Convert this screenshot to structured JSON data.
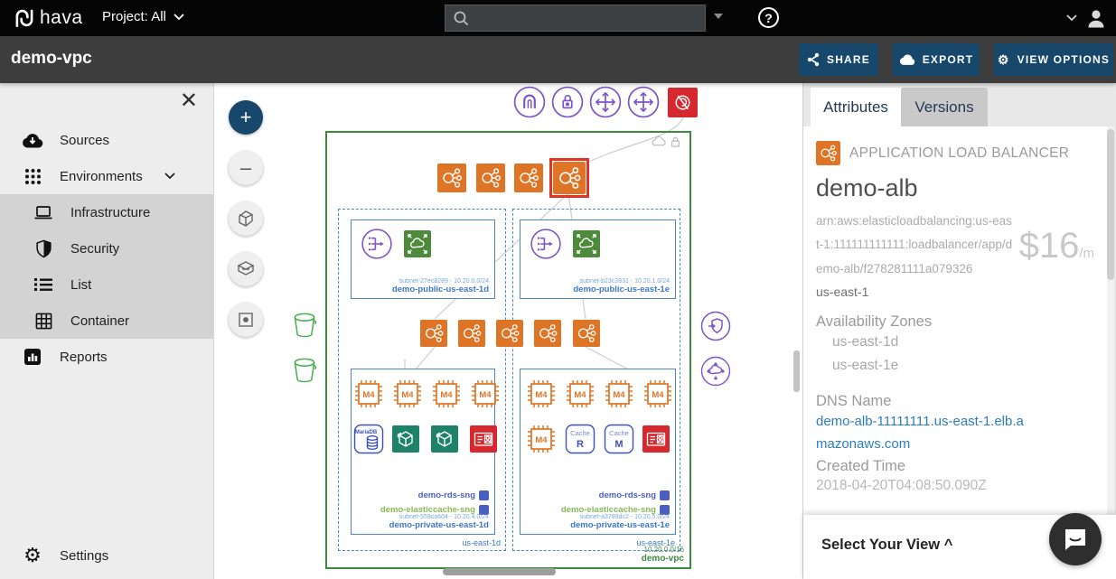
{
  "topbar": {
    "logo_text": "hava",
    "project_label": "Project: All",
    "search_placeholder": ""
  },
  "titlebar": {
    "title": "demo-vpc",
    "share_label": "SHARE",
    "export_label": "EXPORT",
    "view_options_label": "VIEW OPTIONS"
  },
  "sidebar": {
    "items": [
      {
        "label": "Sources"
      },
      {
        "label": "Environments"
      },
      {
        "label": "Infrastructure"
      },
      {
        "label": "Security"
      },
      {
        "label": "List"
      },
      {
        "label": "Container"
      },
      {
        "label": "Reports"
      }
    ],
    "settings_label": "Settings"
  },
  "canvas": {
    "labels": {
      "m4": "M4",
      "mariadb": "MariaDB",
      "cache": "Cache",
      "cache_r": "R",
      "cache_m": "M"
    },
    "vpc": {
      "cidr": "10.20.0.0/16",
      "name": "demo-vpc"
    },
    "azs": [
      {
        "name": "us-east-1d"
      },
      {
        "name": "us-east-1e"
      }
    ],
    "subnets": [
      {
        "meta": "subnet-27ec8289 - 10.20.0.0/24",
        "name": "demo-public-us-east-1d"
      },
      {
        "meta": "subnet-b23c2831 - 10.20.1.0/24",
        "name": "demo-public-us-east-1e"
      },
      {
        "sg1": "demo-rds-sng",
        "sg2": "demo-elasticcache-sng",
        "meta": "subnet-559ca604 - 10.20.4.0/24",
        "name": "demo-private-us-east-1d"
      },
      {
        "sg1": "demo-rds-sng",
        "sg2": "demo-elasticcache-sng",
        "meta": "subnet-a3789dc2 - 10.20.5.0/24",
        "name": "demo-private-us-east-1e"
      }
    ]
  },
  "panel": {
    "tabs": [
      {
        "label": "Attributes"
      },
      {
        "label": "Versions"
      }
    ],
    "resource_type": "APPLICATION LOAD BALANCER",
    "resource_name": "demo-alb",
    "arn": "arn:aws:elasticloadbalancing:us-east-1:111111111111:loadbalancer/app/demo-alb/f278281111a079326",
    "price": "$16",
    "price_unit": "/m",
    "region": "us-east-1",
    "az_heading": "Availability Zones",
    "azs": [
      "us-east-1d",
      "us-east-1e"
    ],
    "dns_heading": "DNS Name",
    "dns_name": "demo-alb-11111111.us-east-1.elb.amazonaws.com",
    "created_heading": "Created Time",
    "created_time": "2018-04-20T04:08:50.090Z"
  },
  "footer": {
    "select_view_label": "Select Your View ^"
  },
  "colors": {
    "accent_navy": "#17476B",
    "aws_orange": "#DE7526",
    "selection_red": "#E23425",
    "resource_red": "#D7282F",
    "subnet_blue": "#4A86C8",
    "vpc_green": "#3D8B3D",
    "nat_green": "#4D8A3C",
    "cache_teal": "#1E8268",
    "purple": "#7D55C7",
    "link_blue": "#2D7DBD"
  }
}
